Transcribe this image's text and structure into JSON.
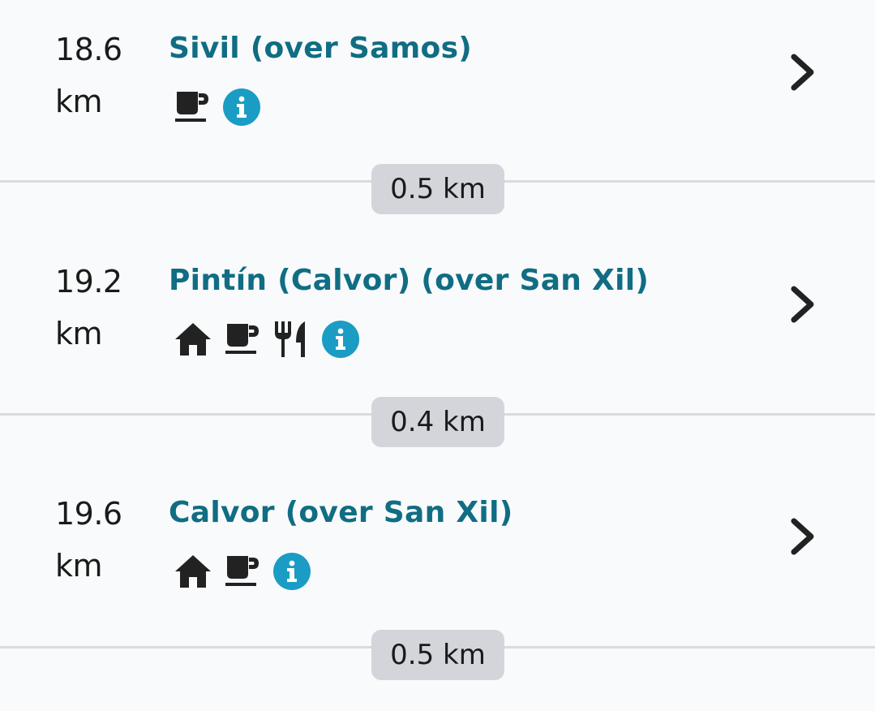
{
  "stops": [
    {
      "distance_value": "18.6",
      "distance_unit": "km",
      "name": "Sivil (over Samos)",
      "amenities": [
        "coffee-icon",
        "info-icon"
      ]
    },
    {
      "distance_value": "19.2",
      "distance_unit": "km",
      "name": "Pintín (Calvor) (over San Xil)",
      "amenities": [
        "house-icon",
        "coffee-icon",
        "restaurant-icon",
        "info-icon"
      ]
    },
    {
      "distance_value": "19.6",
      "distance_unit": "km",
      "name": "Calvor (over San Xil)",
      "amenities": [
        "house-icon",
        "coffee-icon",
        "info-icon"
      ]
    }
  ],
  "segments": [
    {
      "label": "0.5 km"
    },
    {
      "label": "0.4 km"
    },
    {
      "label": "0.5 km"
    }
  ],
  "colors": {
    "name_text": "#106d83",
    "info_badge": "#1a9cc4",
    "icon_dark": "#222222",
    "pill_bg": "#d3d5da",
    "divider": "#d9dbde"
  }
}
